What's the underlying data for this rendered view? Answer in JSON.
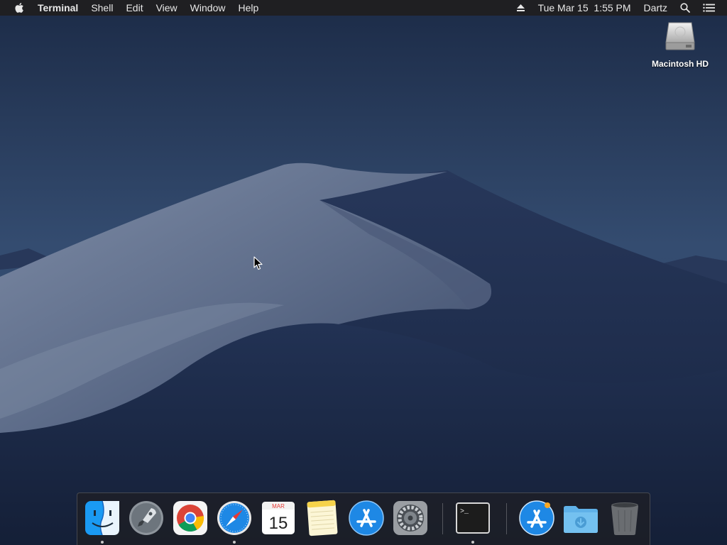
{
  "menubar": {
    "app_name": "Terminal",
    "menus": [
      "Shell",
      "Edit",
      "View",
      "Window",
      "Help"
    ],
    "clock": "Tue Mar 15  1:55 PM",
    "user": "Dartz",
    "icons": {
      "apple": "apple-logo-icon",
      "eject": "eject-icon",
      "search": "spotlight-search-icon",
      "notifications": "notification-center-icon"
    }
  },
  "desktop": {
    "icons": [
      {
        "label": "Macintosh HD",
        "icon": "hard-drive-icon"
      }
    ]
  },
  "calendar": {
    "month": "MAR",
    "day": "15"
  },
  "terminal_prompt": ">_",
  "dock": {
    "items": [
      {
        "name": "Finder",
        "icon": "finder-icon",
        "running": true
      },
      {
        "name": "Launchpad",
        "icon": "launchpad-icon",
        "running": false
      },
      {
        "name": "Google Chrome",
        "icon": "chrome-icon",
        "running": false
      },
      {
        "name": "Safari",
        "icon": "safari-icon",
        "running": true
      },
      {
        "name": "Calendar",
        "icon": "calendar-icon",
        "running": false
      },
      {
        "name": "Notes",
        "icon": "notes-icon",
        "running": false
      },
      {
        "name": "App Store",
        "icon": "app-store-icon",
        "running": false
      },
      {
        "name": "System Preferences",
        "icon": "system-preferences-icon",
        "running": false
      },
      {
        "name": "Terminal",
        "icon": "terminal-icon",
        "running": true
      },
      {
        "name": "Applications",
        "icon": "applications-folder-icon",
        "running": false
      },
      {
        "name": "Downloads",
        "icon": "downloads-folder-icon",
        "running": false
      },
      {
        "name": "Trash",
        "icon": "trash-icon",
        "running": false
      }
    ]
  },
  "colors": {
    "menubar_bg": "#1f1f22",
    "sky_top": "#1d2d4a",
    "dune_light": "#8d9bb3",
    "dune_dark": "#1c2a47",
    "accent_blue": "#1e88e5"
  }
}
